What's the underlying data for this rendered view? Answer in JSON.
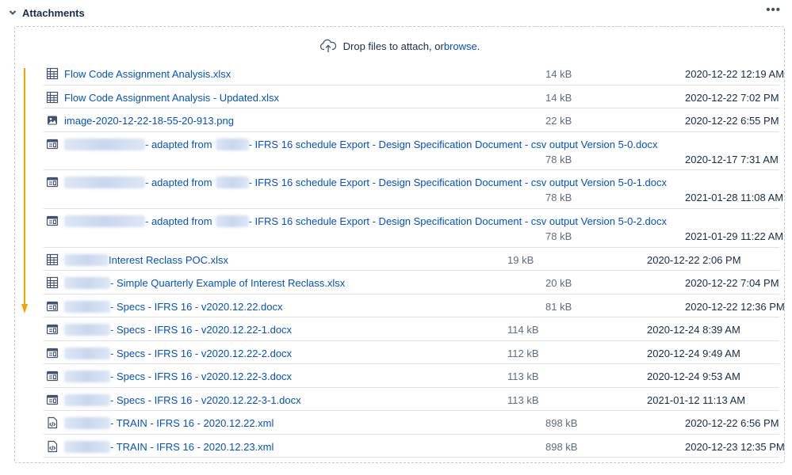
{
  "header": {
    "title": "Attachments",
    "more_label": "•••"
  },
  "dropzone": {
    "text": "Drop files to attach, or ",
    "link": "browse",
    "suffix": "."
  },
  "files": [
    {
      "pre": "",
      "name": "Flow Code Assignment Analysis.xlsx",
      "size": "14 kB",
      "date": "2020-12-22 12:19 AM",
      "icon": "spreadsheet-icon"
    },
    {
      "pre": "",
      "name": "Flow Code Assignment Analysis - Updated.xlsx",
      "size": "14 kB",
      "date": "2020-12-22 7:02 PM",
      "icon": "spreadsheet-icon"
    },
    {
      "pre": "",
      "name": "image-2020-12-22-18-55-20-913.png",
      "size": "22 kB",
      "date": "2020-12-22 6:55 PM",
      "icon": "image-icon"
    },
    {
      "pre": "",
      "name": "- adapted from",
      "mid": "- IFRS 16 schedule Export - Design Specification Document - csv output Version 5-0.docx",
      "size": "78 kB",
      "date": "2020-12-17 7:31 AM",
      "icon": "document-icon"
    },
    {
      "pre": "",
      "name": "- adapted from",
      "mid": "- IFRS 16 schedule Export - Design Specification Document - csv output Version 5-0-1.docx",
      "size": "78 kB",
      "date": "2021-01-28 11:08 AM",
      "icon": "document-icon"
    },
    {
      "pre": "",
      "name": "- adapted from",
      "mid": "- IFRS 16 schedule Export - Design Specification Document - csv output Version 5-0-2.docx",
      "size": "78 kB",
      "date": "2021-01-29 11:22 AM",
      "icon": "document-icon"
    },
    {
      "pre": "",
      "name": "Interest Reclass POC.xlsx",
      "size": "19 kB",
      "date": "2020-12-22 2:06 PM",
      "icon": "spreadsheet-icon"
    },
    {
      "pre": "",
      "name": "- Simple Quarterly Example of Interest Reclass.xlsx",
      "size": "20 kB",
      "date": "2020-12-22 7:04 PM",
      "icon": "spreadsheet-icon"
    },
    {
      "pre": "",
      "name": "- Specs - IFRS 16 - v2020.12.22.docx",
      "size": "81 kB",
      "date": "2020-12-22 12:36 PM",
      "icon": "document-icon"
    },
    {
      "pre": "",
      "name": "- Specs - IFRS 16 - v2020.12.22-1.docx",
      "size": "114 kB",
      "date": "2020-12-24 8:39 AM",
      "icon": "document-icon"
    },
    {
      "pre": "",
      "name": "- Specs - IFRS 16 - v2020.12.22-2.docx",
      "size": "112 kB",
      "date": "2020-12-24 9:49 AM",
      "icon": "document-icon"
    },
    {
      "pre": "",
      "name": "- Specs - IFRS 16 - v2020.12.22-3.docx",
      "size": "113 kB",
      "date": "2020-12-24 9:53 AM",
      "icon": "document-icon"
    },
    {
      "pre": "",
      "name": "- Specs - IFRS 16 - v2020.12.22-3-1.docx",
      "size": "113 kB",
      "date": "2021-01-12 11:13 AM",
      "icon": "document-icon"
    },
    {
      "pre": "",
      "name": "- TRAIN - IFRS 16 - 2020.12.22.xml",
      "size": "898 kB",
      "date": "2020-12-22 6:56 PM",
      "icon": "code-file-icon"
    },
    {
      "pre": "",
      "name": "- TRAIN - IFRS 16 - 2020.12.23.xml",
      "size": "898 kB",
      "date": "2020-12-23 12:35 PM",
      "icon": "code-file-icon"
    }
  ]
}
